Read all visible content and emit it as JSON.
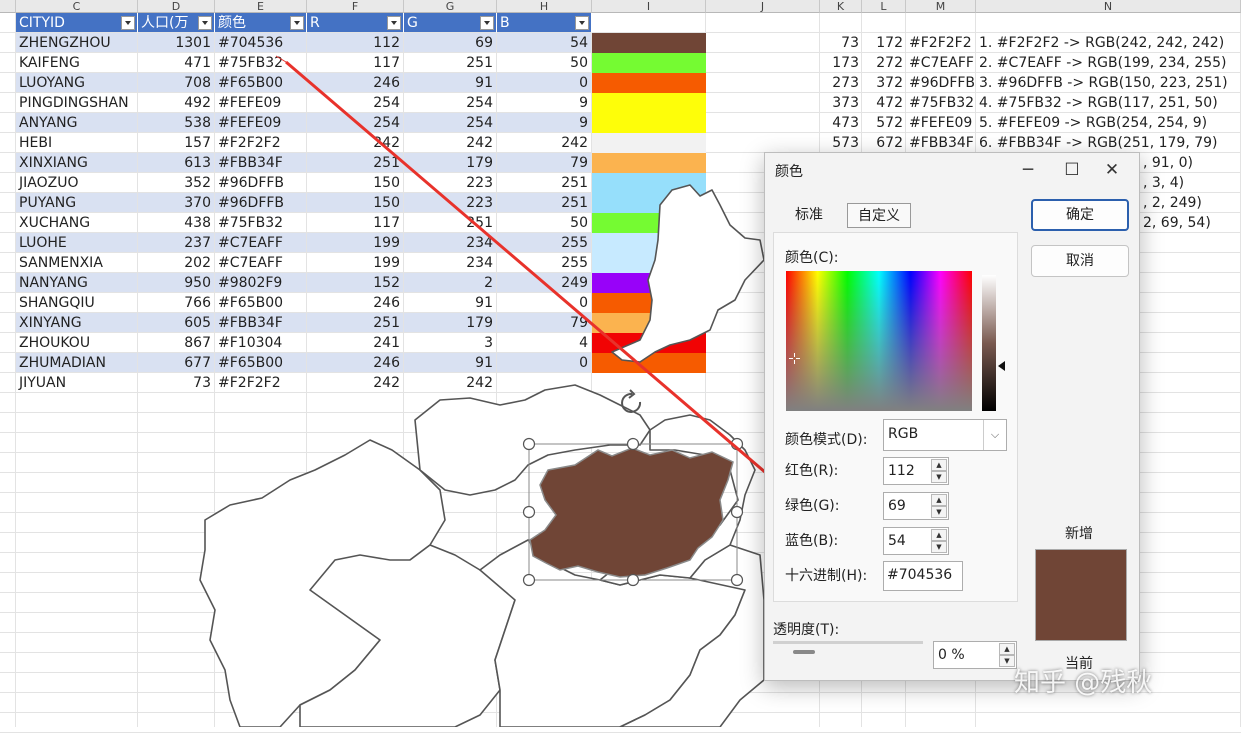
{
  "columns": [
    "C",
    "D",
    "E",
    "F",
    "G",
    "H",
    "I",
    "J",
    "K",
    "L",
    "M",
    "N"
  ],
  "table": {
    "headers": [
      "CITYID",
      "人口(万",
      "颜色",
      "R",
      "G",
      "B"
    ],
    "rows": [
      [
        "ZHENGZHOU",
        "1301",
        "#704536",
        "112",
        "69",
        "54"
      ],
      [
        "KAIFENG",
        "471",
        "#75FB32",
        "117",
        "251",
        "50"
      ],
      [
        "LUOYANG",
        "708",
        "#F65B00",
        "246",
        "91",
        "0"
      ],
      [
        "PINGDINGSHAN",
        "492",
        "#FEFE09",
        "254",
        "254",
        "9"
      ],
      [
        "ANYANG",
        "538",
        "#FEFE09",
        "254",
        "254",
        "9"
      ],
      [
        "HEBI",
        "157",
        "#F2F2F2",
        "242",
        "242",
        "242"
      ],
      [
        "XINXIANG",
        "613",
        "#FBB34F",
        "251",
        "179",
        "79"
      ],
      [
        "JIAOZUO",
        "352",
        "#96DFFB",
        "150",
        "223",
        "251"
      ],
      [
        "PUYANG",
        "370",
        "#96DFFB",
        "150",
        "223",
        "251"
      ],
      [
        "XUCHANG",
        "438",
        "#75FB32",
        "117",
        "251",
        "50"
      ],
      [
        "LUOHE",
        "237",
        "#C7EAFF",
        "199",
        "234",
        "255"
      ],
      [
        "SANMENXIA",
        "202",
        "#C7EAFF",
        "199",
        "234",
        "255"
      ],
      [
        "NANYANG",
        "950",
        "#9802F9",
        "152",
        "2",
        "249"
      ],
      [
        "SHANGQIU",
        "766",
        "#F65B00",
        "246",
        "91",
        "0"
      ],
      [
        "XINYANG",
        "605",
        "#FBB34F",
        "251",
        "179",
        "79"
      ],
      [
        "ZHOUKOU",
        "867",
        "#F10304",
        "241",
        "3",
        "4"
      ],
      [
        "ZHUMADIAN",
        "677",
        "#F65B00",
        "246",
        "91",
        "0"
      ],
      [
        "JIYUAN",
        "73",
        "#F2F2F2",
        "242",
        "242",
        ""
      ]
    ]
  },
  "swatches": [
    "#704536",
    "#75FB32",
    "#F65B00",
    "#FEFE09",
    "#FEFE09",
    "#F2F2F2",
    "#FBB34F",
    "#96DFFB",
    "#96DFFB",
    "#75FB32",
    "#C7EAFF",
    "#C7EAFF",
    "#9802F9",
    "#F65B00",
    "#FBB34F",
    "#F10304",
    "#F65B00"
  ],
  "right_list": [
    [
      "73",
      "172",
      "#F2F2F2",
      "1. #F2F2F2 -> RGB(242, 242, 242)"
    ],
    [
      "173",
      "272",
      "#C7EAFF",
      "2. #C7EAFF -> RGB(199, 234, 255)"
    ],
    [
      "273",
      "372",
      "#96DFFB",
      "3. #96DFFB -> RGB(150, 223, 251)"
    ],
    [
      "373",
      "472",
      "#75FB32",
      "4. #75FB32 -> RGB(117, 251, 50)"
    ],
    [
      "473",
      "572",
      "#FEFE09",
      "5. #FEFE09 -> RGB(254, 254, 9)"
    ],
    [
      "573",
      "672",
      "#FBB34F",
      "6. #FBB34F -> RGB(251, 179, 79)"
    ]
  ],
  "right_list_fragments": [
    ", 91, 0)",
    ", 3, 4)",
    ", 2, 249)",
    "2, 69, 54)"
  ],
  "shape_fill": "#704536",
  "dialog": {
    "title": "颜色",
    "tabs": [
      "标准",
      "自定义"
    ],
    "color_label": "颜色(C):",
    "mode_label": "颜色模式(D):",
    "mode_value": "RGB",
    "red_label": "红色(R):",
    "red_value": "112",
    "green_label": "绿色(G):",
    "green_value": "69",
    "blue_label": "蓝色(B):",
    "blue_value": "54",
    "hex_label": "十六进制(H):",
    "hex_value": "#704536",
    "transparency_label": "透明度(T):",
    "transparency_value": "0 %",
    "ok": "确定",
    "cancel": "取消",
    "new_label": "新增",
    "current_label": "当前",
    "new_color": "#704536"
  },
  "watermark": "知乎 @残秋"
}
